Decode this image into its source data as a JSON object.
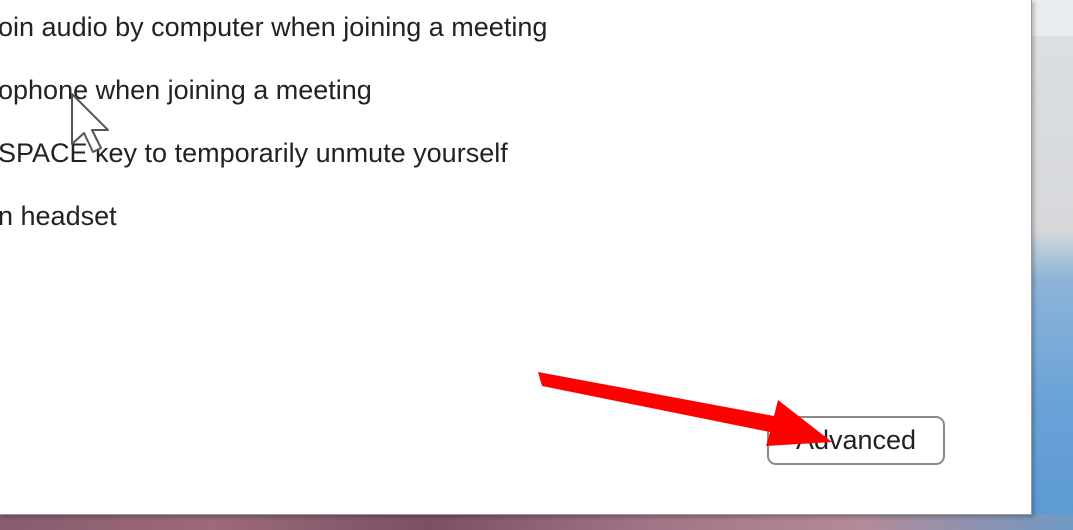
{
  "options": [
    {
      "label": "oin audio by computer when joining a meeting"
    },
    {
      "label": "ophone when joining a meeting"
    },
    {
      "label": " SPACE key to temporarily unmute yourself"
    },
    {
      "label": "n headset"
    }
  ],
  "buttons": {
    "advanced_label": "Advanced"
  },
  "annotation": {
    "arrow_color": "#ff0000",
    "arrow_icon": "red-arrow-icon"
  },
  "cursor_icon": "mouse-pointer-icon"
}
